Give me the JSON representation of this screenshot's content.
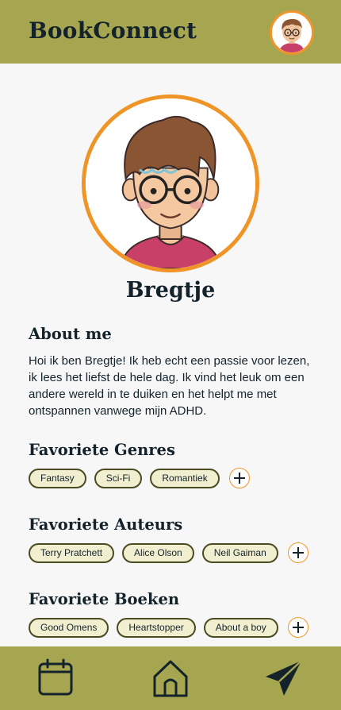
{
  "app": {
    "title": "BookConnect"
  },
  "profile": {
    "name": "Bregtje",
    "about_title": "About me",
    "about_text": "Hoi ik ben Bregtje! Ik heb echt een passie voor lezen, ik lees het liefst de hele dag. Ik vind het leuk om een andere wereld in te duiken en het helpt me met ontspannen vanwege mijn ADHD."
  },
  "genres": {
    "title": "Favoriete Genres",
    "items": [
      "Fantasy",
      "Sci-Fi",
      "Romantiek"
    ]
  },
  "authors": {
    "title": "Favoriete Auteurs",
    "items": [
      "Terry Pratchett",
      "Alice Olson",
      "Neil Gaiman"
    ]
  },
  "books": {
    "title": "Favoriete Boeken",
    "items": [
      "Good Omens",
      "Heartstopper",
      "About a boy"
    ]
  },
  "nav": {
    "icons": [
      "calendar-icon",
      "home-icon",
      "send-icon"
    ]
  },
  "colors": {
    "bar": "#a6a651",
    "accent": "#f0952a",
    "chip_bg": "#f1efd0",
    "chip_border": "#4b4b22",
    "text": "#14232b"
  }
}
